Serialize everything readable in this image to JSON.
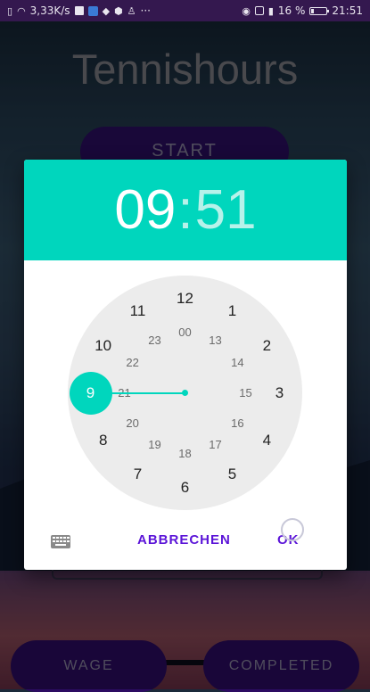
{
  "status_bar": {
    "net_speed": "3,33K/s",
    "battery_text": "16 %",
    "battery_level": 0.16,
    "time": "21:51",
    "overflow": "···"
  },
  "app": {
    "title": "Tennishours",
    "start_label": "START",
    "wage_label": "WAGE",
    "completed_label": "COMPLETED"
  },
  "time_picker": {
    "hour": "09",
    "separator": ":",
    "minute": "51",
    "selected_hour": "9",
    "outer_numbers": [
      "12",
      "1",
      "2",
      "3",
      "4",
      "5",
      "6",
      "7",
      "8",
      "9",
      "10",
      "11"
    ],
    "inner_numbers": [
      "00",
      "13",
      "14",
      "15",
      "16",
      "17",
      "18",
      "19",
      "20",
      "21",
      "22",
      "23"
    ],
    "cancel_label": "ABBRECHEN",
    "ok_label": "OK",
    "accent_color": "#00d6bd",
    "button_color": "#5b14d8"
  }
}
